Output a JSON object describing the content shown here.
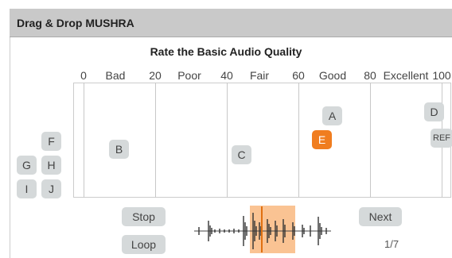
{
  "header": {
    "title": "Drag & Drop MUSHRA"
  },
  "main": {
    "subtitle": "Rate the Basic Audio Quality",
    "scale_ticks": [
      "0",
      "20",
      "40",
      "60",
      "80",
      "100"
    ],
    "scale_categories": [
      "Bad",
      "Poor",
      "Fair",
      "Good",
      "Excellent"
    ],
    "rated_items": [
      {
        "label": "A",
        "score": 66
      },
      {
        "label": "B",
        "score": 10
      },
      {
        "label": "C",
        "score": 44
      },
      {
        "label": "D",
        "score": 97
      },
      {
        "label": "E",
        "score": 64,
        "active": true
      },
      {
        "label": "REF",
        "score": 99
      }
    ],
    "unrated_items": [
      "F",
      "G",
      "H",
      "I",
      "J"
    ]
  },
  "controls": {
    "stop_label": "Stop",
    "loop_label": "Loop",
    "next_label": "Next",
    "counter": "1/7"
  },
  "colors": {
    "accent": "#f07d1f",
    "chip": "#d5d9da",
    "loop_region": "#f9b980",
    "header": "#c9c9c9"
  }
}
